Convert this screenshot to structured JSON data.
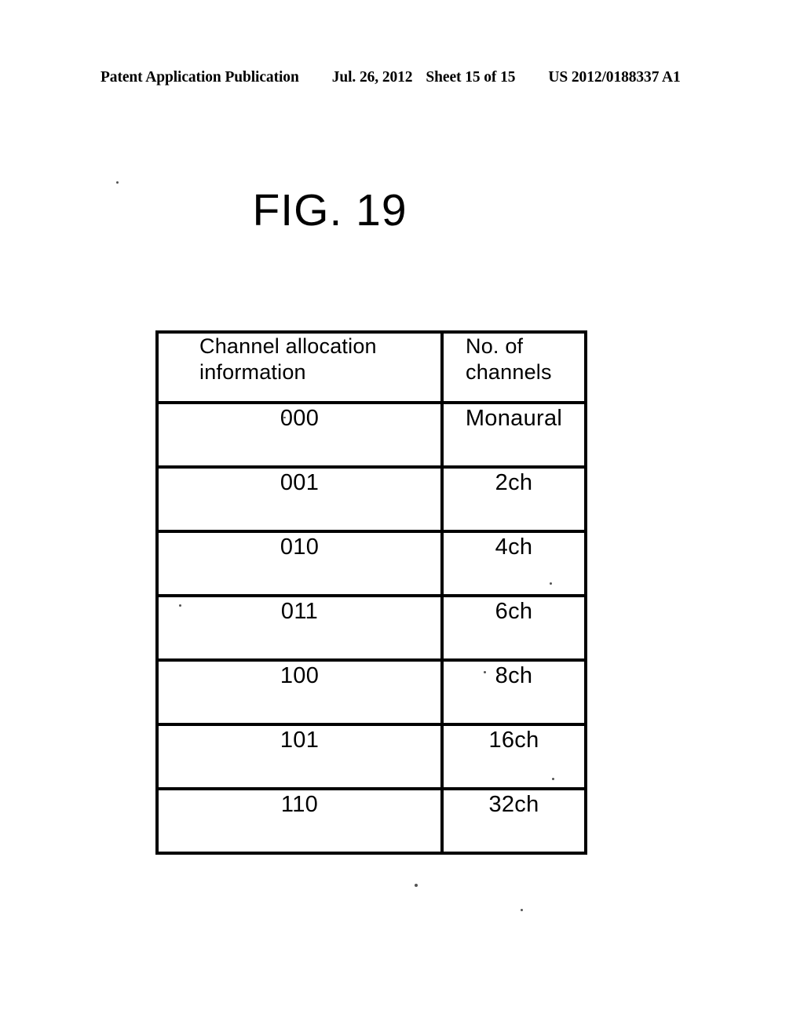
{
  "sheet_header": {
    "publication": "Patent Application Publication",
    "date": "Jul. 26, 2012",
    "sheet": "Sheet 15 of 15",
    "patent_number": "US 2012/0188337 A1"
  },
  "figure": {
    "title": "FIG. 19"
  },
  "table": {
    "headers": [
      "Channel allocation information",
      "No. of channels"
    ],
    "rows": [
      {
        "allocation": "000",
        "channels": "Monaural"
      },
      {
        "allocation": "001",
        "channels": "2ch"
      },
      {
        "allocation": "010",
        "channels": "4ch"
      },
      {
        "allocation": "011",
        "channels": "6ch"
      },
      {
        "allocation": "100",
        "channels": "8ch"
      },
      {
        "allocation": "101",
        "channels": "16ch"
      },
      {
        "allocation": "110",
        "channels": "32ch"
      }
    ]
  },
  "colors": {
    "ink": "#000000",
    "paper": "#ffffff"
  }
}
